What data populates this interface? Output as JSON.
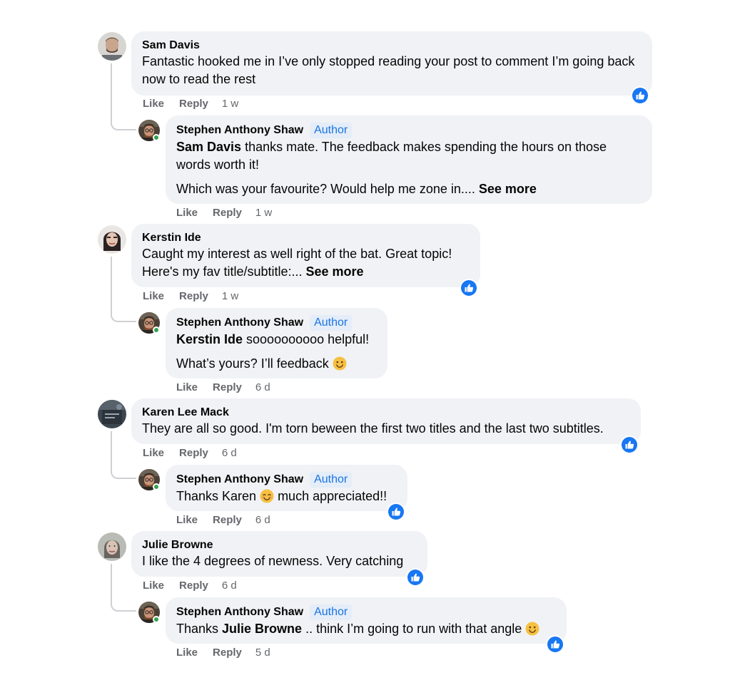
{
  "actions": {
    "like": "Like",
    "reply": "Reply"
  },
  "author_badge": "Author",
  "see_more": "See more",
  "colors": {
    "bubble": "#f0f2f5",
    "like_blue": "#1877f2",
    "author_badge_bg": "#e4edf8",
    "author_badge_text": "#1b74e4",
    "meta_gray": "#65676b",
    "online_green": "#31a24c"
  },
  "icons": {
    "like_reaction": "thumbs-up-icon",
    "smile": "slightly-smiling-face-emoji",
    "blush": "smiling-face-with-smiling-eyes-emoji"
  },
  "comments": [
    {
      "name": "Sam Davis",
      "text": "Fantastic hooked me in I’ve only stopped reading your post to comment I’m going back now to read the rest",
      "time": "1 w",
      "reply": {
        "name": "Stephen Anthony Shaw",
        "mention": "Sam Davis",
        "text": " thanks mate. The feedback makes spending the hours on those words worth it!",
        "para2": "Which was your favourite? Would help me zone in.... ",
        "time": "1 w"
      }
    },
    {
      "name": "Kerstin Ide",
      "text_line1": "Caught my interest as well right of the bat. Great topic!",
      "text_line2": "Here's my fav title/subtitle:... ",
      "time": "1 w",
      "reply": {
        "name": "Stephen Anthony Shaw",
        "mention": "Kerstin Ide",
        "text": " soooooooooo helpful!",
        "para2": "What’s yours? I’ll feedback ",
        "time": "6 d"
      }
    },
    {
      "name": "Karen Lee Mack",
      "text": "They are all so good. I'm torn beween the first two titles and the last two subtitles.",
      "time": "6 d",
      "reply": {
        "name": "Stephen Anthony Shaw",
        "text_before": "Thanks Karen ",
        "text_after": " much appreciated!!",
        "time": "6 d"
      }
    },
    {
      "name": "Julie Browne",
      "text": "I like the 4 degrees of newness. Very catching",
      "time": "6 d",
      "reply": {
        "name": "Stephen Anthony Shaw",
        "text_before": "Thanks ",
        "mention": "Julie Browne",
        "text_after": " .. think I’m going to run with that angle ",
        "time": "5 d"
      }
    }
  ]
}
